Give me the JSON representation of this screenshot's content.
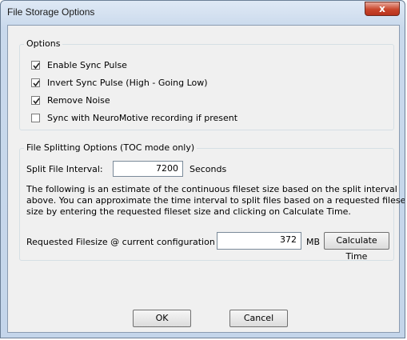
{
  "window": {
    "title": "File Storage Options",
    "close_label": "x"
  },
  "options": {
    "legend": "Options",
    "items": [
      {
        "label": "Enable Sync Pulse",
        "checked": true
      },
      {
        "label": "Invert Sync Pulse (High - Going Low)",
        "checked": true
      },
      {
        "label": "Remove Noise",
        "checked": true
      },
      {
        "label": "Sync with NeuroMotive recording if present",
        "checked": false
      }
    ]
  },
  "splitting": {
    "legend": "File Splitting Options (TOC mode only)",
    "interval_label": "Split File Interval:",
    "interval_value": "7200",
    "interval_unit": "Seconds",
    "description": [
      "The following is an estimate of the continuous fileset size based on the split interval",
      "above.  You can approximate the time interval to split files based on a requested fileset",
      "size by entering the requested fileset size and clicking on Calculate Time."
    ],
    "filesize_label": "Requested Filesize @ current configuration",
    "filesize_value": "372",
    "filesize_unit": "MB",
    "calculate_label": "Calculate Time"
  },
  "buttons": {
    "ok": "OK",
    "cancel": "Cancel"
  }
}
